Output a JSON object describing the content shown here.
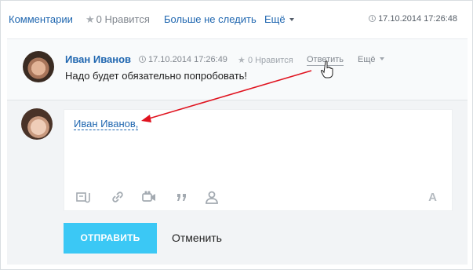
{
  "topbar": {
    "comments_label": "Комментарии",
    "like_label": "0 Нравится",
    "unfollow_label": "Больше не следить",
    "more_label": "Ещё",
    "date": "17.10.2014 17:26:48"
  },
  "comment": {
    "author": "Иван Иванов",
    "date": "17.10.2014 17:26:49",
    "like_label": "0 Нравится",
    "reply_label": "Ответить",
    "more_label": "Ещё",
    "text": "Надо будет обязательно попробовать!"
  },
  "reply": {
    "mention": "Иван Иванов",
    "mention_suffix": ",",
    "send_label": "ОТПРАВИТЬ",
    "cancel_label": "Отменить",
    "font_label": "A",
    "toolbar_icons": [
      "attach-file-icon",
      "link-icon",
      "video-icon",
      "quote-icon",
      "mention-user-icon",
      "font-format-icon"
    ]
  },
  "colors": {
    "link": "#2067b0",
    "accent_button": "#3bc8f5",
    "arrow": "#e0131f",
    "muted": "#80868e"
  }
}
